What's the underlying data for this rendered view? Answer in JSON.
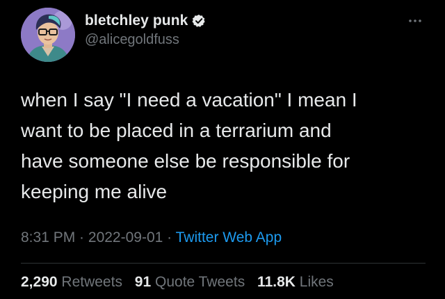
{
  "author": {
    "display_name": "bletchley punk",
    "handle": "@alicegoldfuss",
    "verified": true
  },
  "tweet": {
    "text": "when I say \"I need a vacation\" I mean I\nwant to be placed in a terrarium and\nhave someone else be responsible for\nkeeping me alive",
    "time": "8:31 PM",
    "separator": " · ",
    "date": "2022-09-01",
    "source": "Twitter Web App"
  },
  "stats": {
    "retweets_count": "2,290",
    "retweets_label": "Retweets",
    "quotes_count": "91",
    "quotes_label": "Quote Tweets",
    "likes_count": "11.8K",
    "likes_label": "Likes"
  },
  "icons": {
    "verified": "verified-badge-icon",
    "more": "more-options-icon"
  },
  "colors": {
    "background": "#000000",
    "text_primary": "#e7e9ea",
    "text_secondary": "#71767b",
    "accent": "#1d9bf0",
    "divider": "#2f3336"
  }
}
